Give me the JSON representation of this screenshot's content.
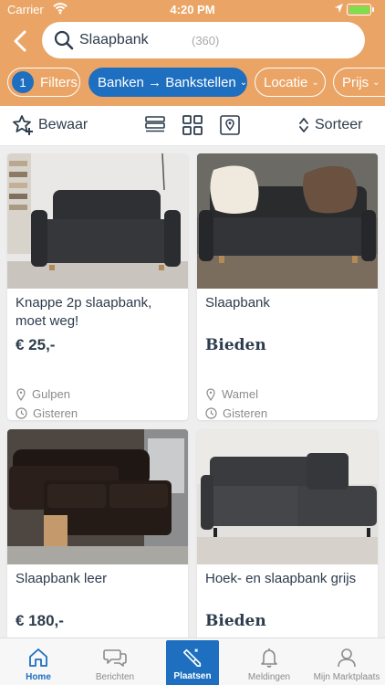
{
  "status_bar": {
    "carrier": "Carrier",
    "time": "4:20 PM"
  },
  "search": {
    "term": "Slaapbank",
    "count": "(360)"
  },
  "chips": {
    "filters_count": "1",
    "filters_label": "Filters",
    "category": "Banken → Bankstellen",
    "location": "Locatie",
    "price": "Prijs"
  },
  "toolbar": {
    "save_label": "Bewaar",
    "sort_label": "Sorteer"
  },
  "listings": [
    {
      "title": "Knappe 2p slaapbank, moet weg!",
      "price": "€ 25,-",
      "location": "Gulpen",
      "date": "Gisteren"
    },
    {
      "title": "Slaapbank",
      "price": "Bieden",
      "location": "Wamel",
      "date": "Gisteren"
    },
    {
      "title": "Slaapbank leer",
      "price": "€ 180,-"
    },
    {
      "title": "Hoek- en slaapbank grijs",
      "price": "Bieden"
    }
  ],
  "tabs": {
    "home": "Home",
    "messages": "Berichten",
    "place": "Plaatsen",
    "notifications": "Meldingen",
    "account": "Mijn Marktplaats"
  },
  "colors": {
    "header": "#eaa566",
    "accent": "#1e6fc0",
    "text": "#2d3c4d"
  },
  "icons": [
    "back-arrow-icon",
    "search-icon",
    "star-save-icon",
    "list-view-icon",
    "grid-view-icon",
    "map-view-icon",
    "sort-icon",
    "location-pin-icon",
    "clock-icon",
    "home-icon",
    "chat-icon",
    "pen-icon",
    "bell-icon",
    "user-icon"
  ]
}
